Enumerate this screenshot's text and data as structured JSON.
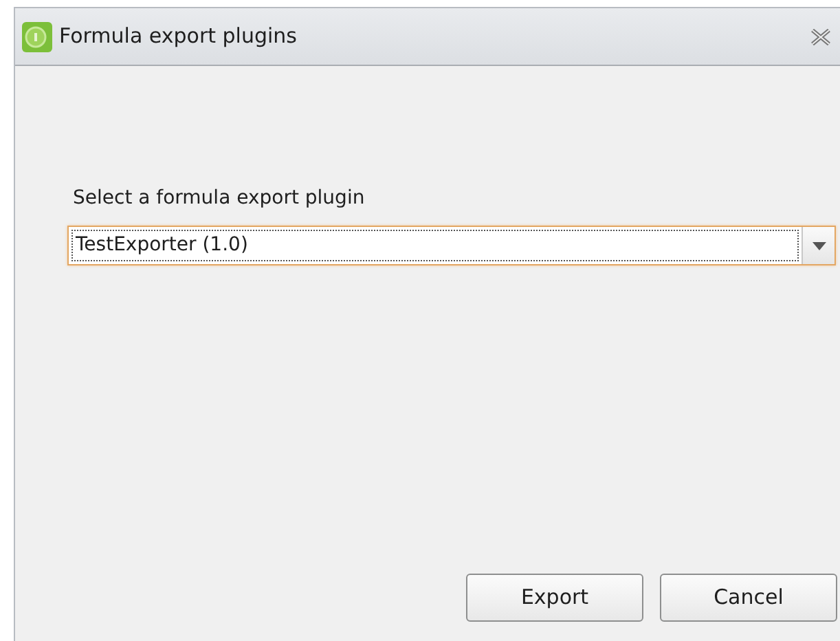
{
  "window": {
    "title": "Formula export plugins"
  },
  "label": "Select a formula export plugin",
  "combo": {
    "value": "TestExporter (1.0)",
    "focused": true
  },
  "buttons": [
    {
      "label": "Export"
    },
    {
      "label": "Cancel"
    }
  ]
}
